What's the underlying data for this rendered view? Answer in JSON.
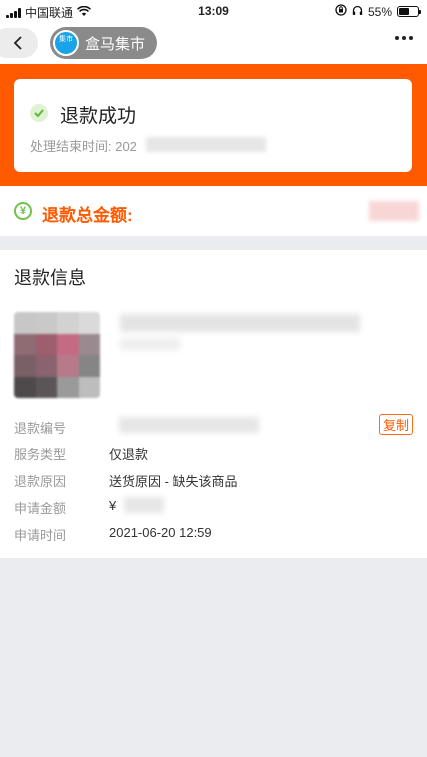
{
  "status_bar": {
    "carrier": "中国联通",
    "time": "13:09",
    "battery_percent": "55%",
    "battery_level": 0.55
  },
  "nav": {
    "shop_logo_text": "集市",
    "shop_name": "盒马集市"
  },
  "status_card": {
    "title": "退款成功",
    "time_label": "处理结束时间: 202",
    "accent_color": "#ff5a00"
  },
  "refund_total": {
    "label": "退款总金额:"
  },
  "refund_info": {
    "title": "退款信息",
    "rows": [
      {
        "label": "退款编号",
        "value": ""
      },
      {
        "label": "服务类型",
        "value": "仅退款"
      },
      {
        "label": "退款原因",
        "value": "送货原因 - 缺失该商品"
      },
      {
        "label": "申请金额",
        "value": "¥"
      },
      {
        "label": "申请时间",
        "value": "2021-06-20 12:59"
      }
    ],
    "copy_label": "复制"
  }
}
